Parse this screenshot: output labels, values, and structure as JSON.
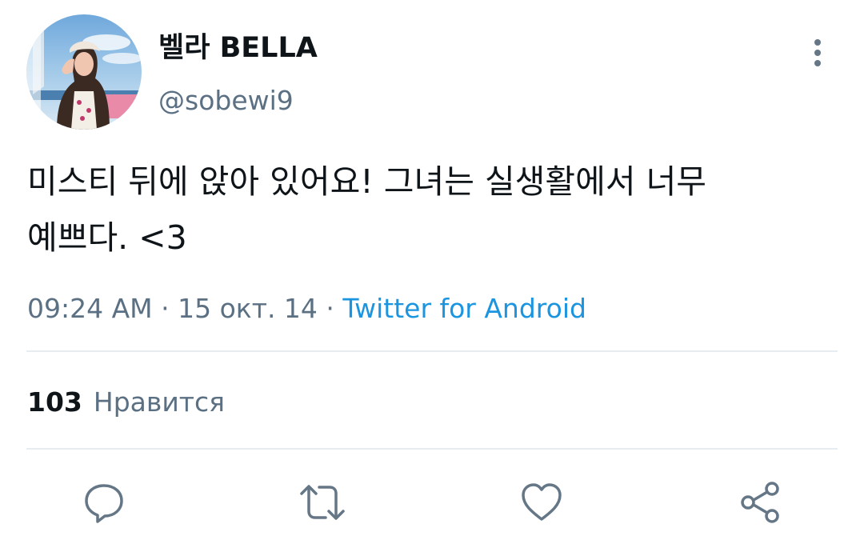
{
  "user": {
    "display_name": "벨라 BELLA",
    "handle": "@sobewi9",
    "avatar_icon": "avatar-photo"
  },
  "header": {
    "more_icon": "more-vertical-icon"
  },
  "tweet": {
    "line1": "미스티 뒤에 앉아 있어요! 그녀는 실생활에서 너무",
    "line2": "예쁘다. <3",
    "time": "09:24 AM",
    "separator": " · ",
    "date": "15 окт. 14",
    "source": "Twitter for Android"
  },
  "stats": {
    "likes_count": "103",
    "likes_label": "Нравится"
  },
  "actions": [
    {
      "name": "reply",
      "icon": "speech-bubble-icon"
    },
    {
      "name": "retweet",
      "icon": "retweet-arrows-icon"
    },
    {
      "name": "like",
      "icon": "heart-icon"
    },
    {
      "name": "share",
      "icon": "share-nodes-icon"
    }
  ],
  "colors": {
    "text": "#0f1419",
    "secondary": "#5b7083",
    "link": "#1b95e0",
    "divider": "#e6ecf0",
    "icon": "#657786"
  }
}
